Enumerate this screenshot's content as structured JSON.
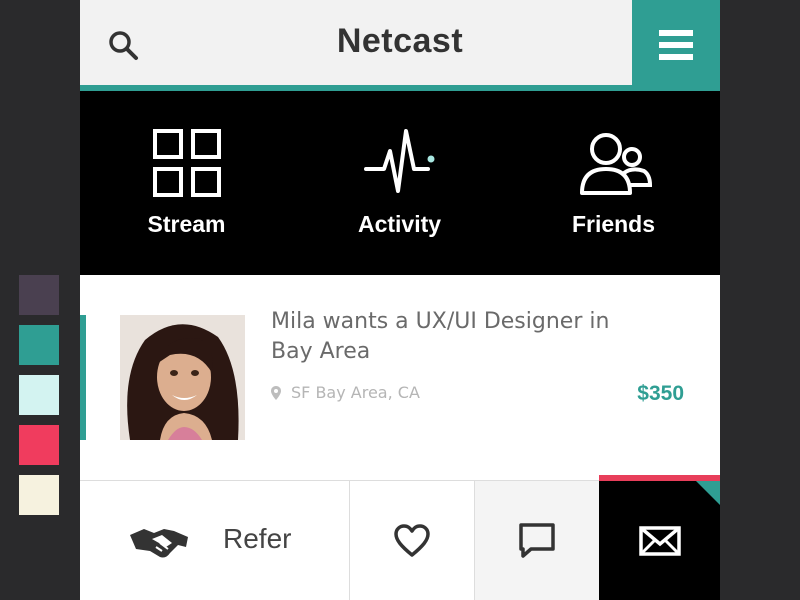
{
  "palette": [
    "#4a4050",
    "#2f9e93",
    "#d3f3f1",
    "#f03c5e",
    "#f6f2df"
  ],
  "header": {
    "title": "Netcast",
    "accent_color": "#2f9e93",
    "search_icon": "search-icon",
    "menu_icon": "hamburger-menu-icon"
  },
  "nav": {
    "items": [
      {
        "label": "Stream",
        "icon": "grid-icon"
      },
      {
        "label": "Activity",
        "icon": "pulse-icon"
      },
      {
        "label": "Friends",
        "icon": "users-icon"
      }
    ]
  },
  "card": {
    "title": "Mila wants a UX/UI Designer in Bay Area",
    "location": "SF Bay Area, CA",
    "price": "$350",
    "avatar": "profile-photo"
  },
  "actions": {
    "refer_label": "Refer",
    "refer_icon": "handshake-icon",
    "like_icon": "heart-icon",
    "comment_icon": "speech-bubble-icon",
    "mail_icon": "envelope-icon",
    "mail_accent": "#e83e5a"
  }
}
